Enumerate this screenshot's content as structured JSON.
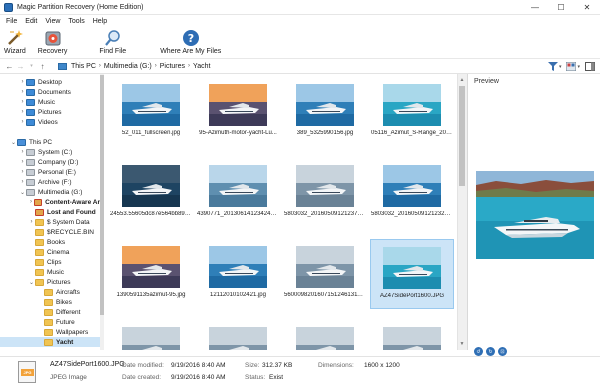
{
  "window": {
    "title": "Magic Partition Recovery (Home Edition)",
    "minimize": "—",
    "maximize": "☐",
    "close": "✕"
  },
  "menu": [
    "File",
    "Edit",
    "View",
    "Tools",
    "Help"
  ],
  "toolbar": [
    {
      "label": "Wizard",
      "icon": "wizard-icon"
    },
    {
      "label": "Recovery",
      "icon": "recovery-icon"
    },
    {
      "label": "Find File",
      "icon": "find-file-icon"
    },
    {
      "label": "Where Are My Files",
      "icon": "help-icon"
    }
  ],
  "address": {
    "crumbs": [
      "This PC",
      "Multimedia (G:)",
      "Pictures",
      "Yacht"
    ],
    "sep": "›"
  },
  "tree": [
    {
      "label": "Desktop",
      "indent": 1,
      "arrow": "›",
      "icon": "special"
    },
    {
      "label": "Documents",
      "indent": 1,
      "arrow": "›",
      "icon": "special"
    },
    {
      "label": "Music",
      "indent": 1,
      "arrow": "›",
      "icon": "special"
    },
    {
      "label": "Pictures",
      "indent": 1,
      "arrow": "›",
      "icon": "special"
    },
    {
      "label": "Videos",
      "indent": 1,
      "arrow": "›",
      "icon": "special"
    },
    {
      "label": "",
      "indent": 0,
      "arrow": "",
      "icon": "none"
    },
    {
      "label": "This PC",
      "indent": 0,
      "arrow": "⌄",
      "icon": "pc"
    },
    {
      "label": "System (C:)",
      "indent": 1,
      "arrow": "›",
      "icon": "drive"
    },
    {
      "label": "Company (D:)",
      "indent": 1,
      "arrow": "›",
      "icon": "drive"
    },
    {
      "label": "Personal (E:)",
      "indent": 1,
      "arrow": "›",
      "icon": "drive"
    },
    {
      "label": "Archive (F:)",
      "indent": 1,
      "arrow": "›",
      "icon": "drive"
    },
    {
      "label": "Multimedia (G:)",
      "indent": 1,
      "arrow": "⌄",
      "icon": "drive"
    },
    {
      "label": "Content-Aware Ar",
      "indent": 2,
      "arrow": "›",
      "icon": "red",
      "bold": true
    },
    {
      "label": "Lost and Found",
      "indent": 2,
      "arrow": "",
      "icon": "red",
      "bold": true
    },
    {
      "label": "$ System Data",
      "indent": 2,
      "arrow": "›",
      "icon": "folder"
    },
    {
      "label": "$RECYCLE.BIN",
      "indent": 2,
      "arrow": "",
      "icon": "folder"
    },
    {
      "label": "Books",
      "indent": 2,
      "arrow": "",
      "icon": "folder"
    },
    {
      "label": "Cinema",
      "indent": 2,
      "arrow": "",
      "icon": "folder"
    },
    {
      "label": "Clips",
      "indent": 2,
      "arrow": "",
      "icon": "folder"
    },
    {
      "label": "Music",
      "indent": 2,
      "arrow": "",
      "icon": "folder"
    },
    {
      "label": "Pictures",
      "indent": 2,
      "arrow": "⌄",
      "icon": "folder"
    },
    {
      "label": "Aircrafts",
      "indent": 3,
      "arrow": "",
      "icon": "folder"
    },
    {
      "label": "Bikes",
      "indent": 3,
      "arrow": "",
      "icon": "folder"
    },
    {
      "label": "Different",
      "indent": 3,
      "arrow": "",
      "icon": "folder"
    },
    {
      "label": "Future",
      "indent": 3,
      "arrow": "",
      "icon": "folder"
    },
    {
      "label": "Wallpapers",
      "indent": 3,
      "arrow": "",
      "icon": "folder"
    },
    {
      "label": "Yacht",
      "indent": 3,
      "arrow": "",
      "icon": "folder",
      "selected": true,
      "bold": true
    }
  ],
  "files": [
    {
      "name": "52_011_fullscreen.jpg",
      "scene": "blue"
    },
    {
      "name": "95-Azimuth-motor-yacht-Lu...",
      "scene": "sunset"
    },
    {
      "name": "389_5325990156.jpg",
      "scene": "blue"
    },
    {
      "name": "05116_Azimut_S-Range_2011...",
      "scene": "teal"
    },
    {
      "name": "24553.55605dc87e564bb8961...",
      "scene": "dark"
    },
    {
      "name": "4390771_20130614123424458...",
      "scene": "coast"
    },
    {
      "name": "5803032_20160509121237216...",
      "scene": "grey"
    },
    {
      "name": "5803032_20160509121232243...",
      "scene": "blue"
    },
    {
      "name": "1390591135azimut-95.jpg",
      "scene": "sunset"
    },
    {
      "name": "12112010102421.jpg",
      "scene": "blue"
    },
    {
      "name": "5600098201607151246131135...",
      "scene": "grey"
    },
    {
      "name": "AZ47SidePort1600.JPG",
      "scene": "teal",
      "selected": true
    },
    {
      "name": "",
      "scene": "grey"
    },
    {
      "name": "",
      "scene": "grey"
    },
    {
      "name": "",
      "scene": "grey"
    },
    {
      "name": "",
      "scene": "grey"
    }
  ],
  "preview": {
    "title": "Preview"
  },
  "status": {
    "file_name": "AZ47SidePort1600.JPG",
    "file_type": "JPEG Image",
    "file_badge": "JPG",
    "modified_label": "Date modified:",
    "modified_value": "9/19/2016 8:40 AM",
    "created_label": "Date created:",
    "created_value": "9/19/2016 8:40 AM",
    "size_label": "Size:",
    "size_value": "312.37 KB",
    "status_label": "Status:",
    "status_value": "Exist",
    "dimensions_label": "Dimensions:",
    "dimensions_value": "1600 x 1200"
  },
  "colors": {
    "selection": "#cce4f7",
    "accent": "#2b6fb8",
    "folder": "#f0c452"
  }
}
